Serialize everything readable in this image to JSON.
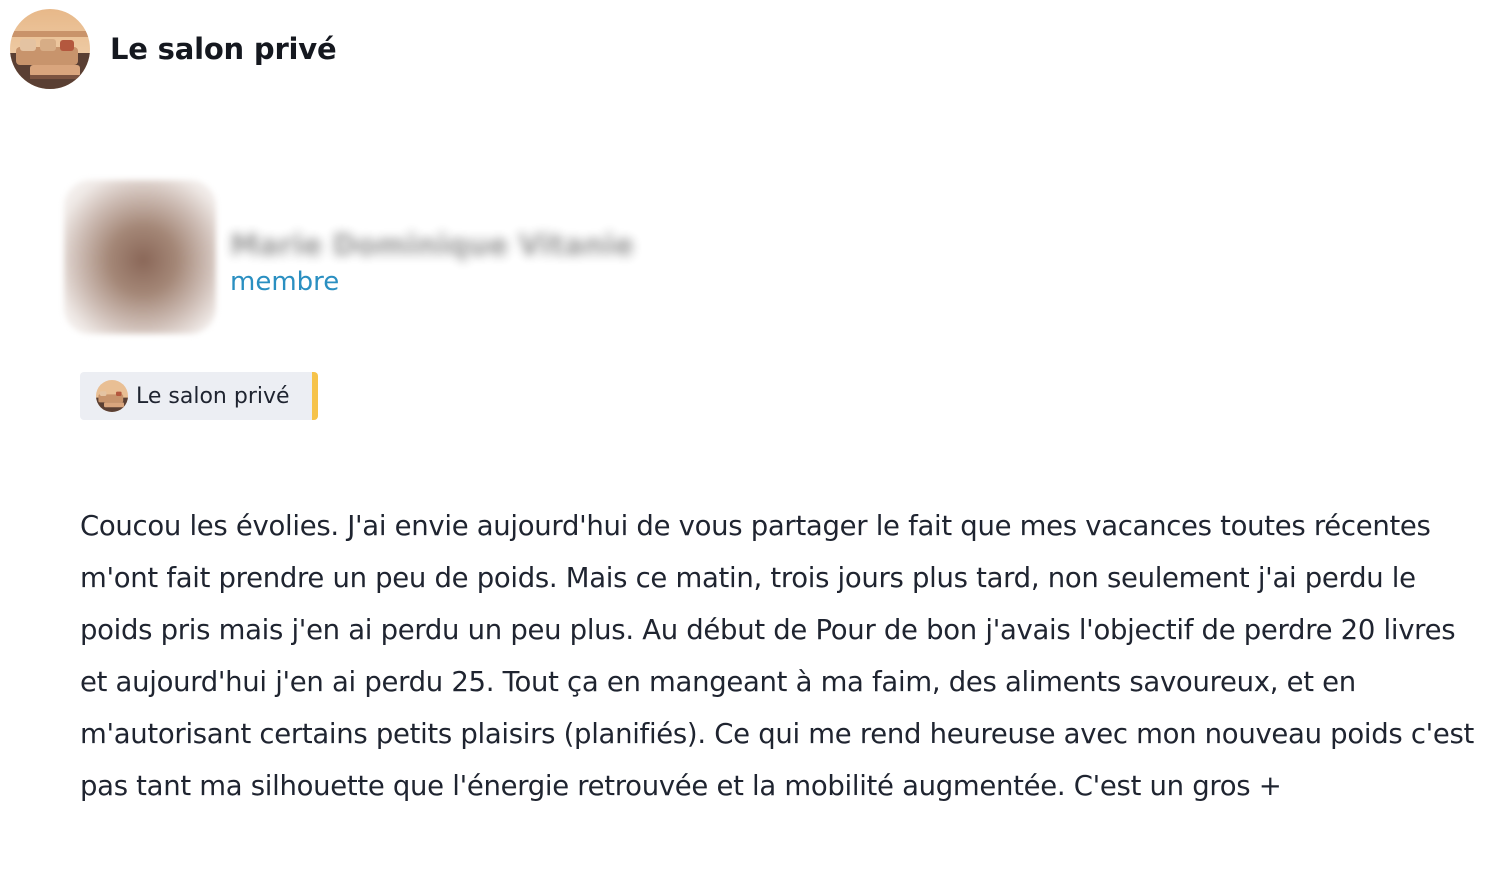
{
  "group": {
    "name": "Le salon privé",
    "avatar_icon": "lounge-sofa-image"
  },
  "author": {
    "name": "Marie Dominique Vitanie",
    "role": "membre",
    "role_color": "#2a8fc1"
  },
  "group_chip": {
    "label": "Le salon privé",
    "accent_color": "#f6c34a"
  },
  "post": {
    "body": "Coucou les évolies. J'ai envie aujourd'hui de vous partager le fait que mes vacances toutes récentes m'ont fait prendre un peu de poids. Mais ce matin, trois jours plus tard, non seulement j'ai perdu le poids pris mais j'en ai perdu un peu plus. Au début de Pour de bon j'avais l'objectif de perdre 20 livres et aujourd'hui j'en ai perdu 25. Tout ça en mangeant à ma faim, des aliments savoureux, et en m'autorisant certains petits plaisirs (planifiés). Ce qui me rend heureuse avec mon nouveau poids c'est pas tant ma silhouette que l'énergie retrouvée et la mobilité augmentée. C'est un gros +"
  }
}
